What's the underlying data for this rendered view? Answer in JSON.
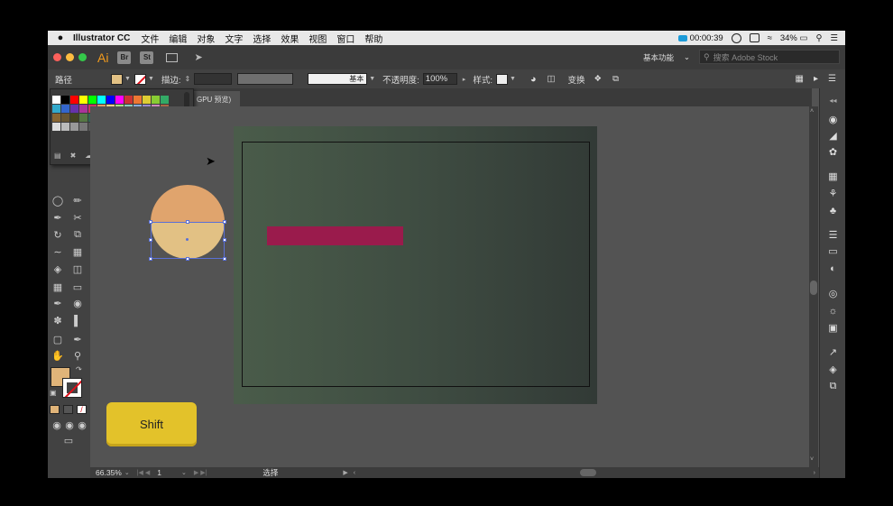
{
  "menubar": {
    "apple": "",
    "app_name": "Illustrator CC",
    "items": [
      "文件",
      "编辑",
      "对象",
      "文字",
      "选择",
      "效果",
      "视图",
      "窗口",
      "帮助"
    ],
    "timer": "00:00:39",
    "battery": "34%"
  },
  "appbar": {
    "logo": "Ai",
    "br_label": "Br",
    "st_label": "St",
    "workspace": "基本功能",
    "stock_placeholder": "搜索 Adobe Stock"
  },
  "control": {
    "object_type": "路径",
    "stroke_label": "描边:",
    "brush_label": "基本",
    "opacity_label": "不透明度:",
    "opacity_value": "100%",
    "style_label": "样式:",
    "transform_label": "变换",
    "fill_color": "#e2c184"
  },
  "document": {
    "tab_label": "GPU 预览)"
  },
  "canvas": {
    "shift_key_label": "Shift",
    "rect_color": "#9a1b4c",
    "circle_top_color": "#e0a46d",
    "circle_bottom_color": "#e2c184"
  },
  "status": {
    "zoom": "66.35%",
    "artboard_number": "1",
    "tool_name": "选择"
  },
  "swatches": {
    "colors": [
      "#ffffff",
      "#000000",
      "#ff0000",
      "#ffff00",
      "#00ff00",
      "#00ffff",
      "#0000ff",
      "#ff00ff",
      "#cc3333",
      "#ee7733",
      "#ddcc33",
      "#88cc33",
      "#33aa66",
      "#33aacc",
      "#3366cc",
      "#6633aa",
      "#aa3399",
      "#cc3366",
      "#dd9966",
      "#eecc88",
      "#aadd88",
      "#88ccbb",
      "#88aadd",
      "#9988cc",
      "#cc88bb",
      "#aa6644",
      "#886633",
      "#665533",
      "#444422",
      "#557744",
      "#336655",
      "#335577",
      "#443366",
      "#663355",
      "#884444",
      "#cc9977",
      "#bbaa88",
      "#999977",
      "#778866",
      "#dddddd",
      "#bbbbbb",
      "#999999",
      "#777777",
      "#555555",
      "#333333",
      "#111111",
      "#f5d6b0",
      "#e2c184",
      "#e0a46d",
      "#9a1b4c",
      "#cc6699",
      "#996699"
    ]
  }
}
